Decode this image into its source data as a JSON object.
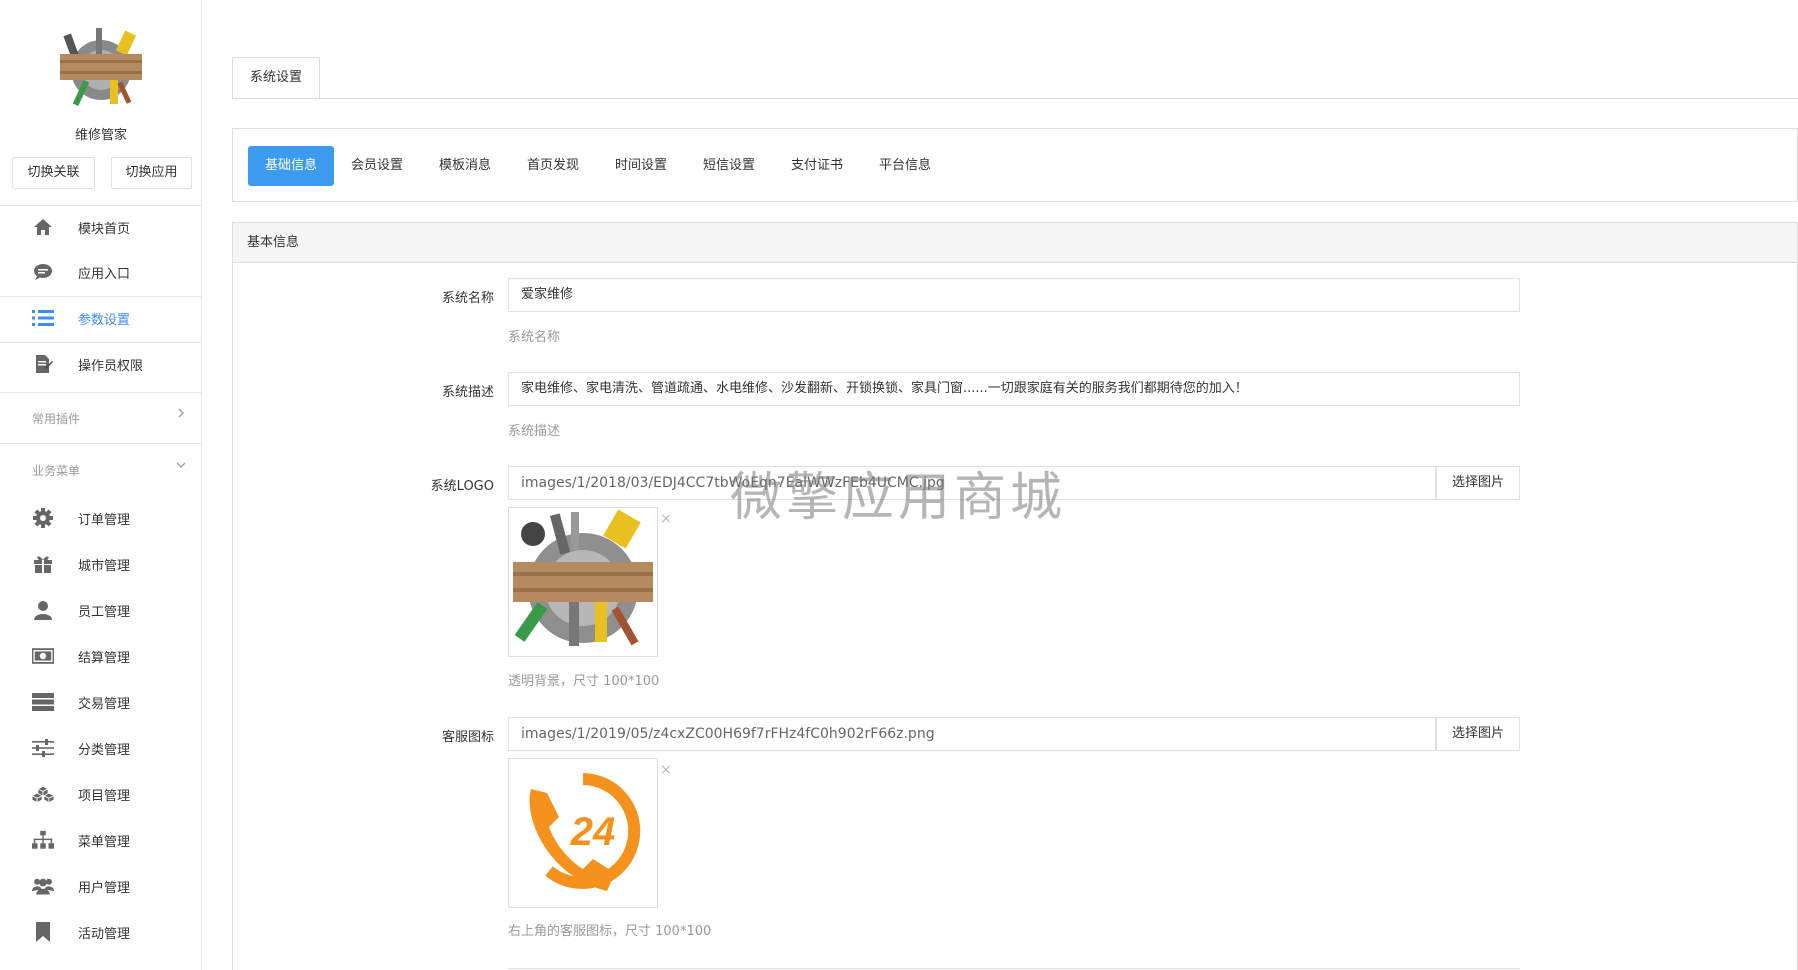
{
  "sidebar": {
    "app_name": "维修管家",
    "switch_link": "切换关联",
    "switch_app": "切换应用",
    "items": [
      {
        "label": "模块首页",
        "icon": "home-icon"
      },
      {
        "label": "应用入口",
        "icon": "chat-icon"
      },
      {
        "label": "参数设置",
        "icon": "list-icon"
      },
      {
        "label": "操作员权限",
        "icon": "edit-doc-icon"
      }
    ],
    "group_plugins": "常用插件",
    "group_business": "业务菜单",
    "business_items": [
      {
        "label": "订单管理",
        "icon": "gear-icon"
      },
      {
        "label": "城市管理",
        "icon": "gift-icon"
      },
      {
        "label": "员工管理",
        "icon": "user-icon"
      },
      {
        "label": "结算管理",
        "icon": "money-icon"
      },
      {
        "label": "交易管理",
        "icon": "server-icon"
      },
      {
        "label": "分类管理",
        "icon": "sliders-icon"
      },
      {
        "label": "项目管理",
        "icon": "cubes-icon"
      },
      {
        "label": "菜单管理",
        "icon": "sitemap-icon"
      },
      {
        "label": "用户管理",
        "icon": "users-icon"
      },
      {
        "label": "活动管理",
        "icon": "bookmark-icon"
      }
    ]
  },
  "main": {
    "top_tab": "系统设置",
    "subtabs": [
      "基础信息",
      "会员设置",
      "模板消息",
      "首页发现",
      "时间设置",
      "短信设置",
      "支付证书",
      "平台信息"
    ],
    "panel_title": "基本信息",
    "fields": {
      "name": {
        "label": "系统名称",
        "value": "爱家维修",
        "help": "系统名称"
      },
      "desc": {
        "label": "系统描述",
        "value": "家电维修、家电清洗、管道疏通、水电维修、沙发翻新、开锁换锁、家具门窗......一切跟家庭有关的服务我们都期待您的加入！",
        "help": "系统描述"
      },
      "logo": {
        "label": "系统LOGO",
        "value": "images/1/2018/03/EDJ4CC7tbWoEqn7EalWWzFEb4UCMC.jpg",
        "button": "选择图片",
        "help": "透明背景，尺寸 100*100"
      },
      "service": {
        "label": "客服图标",
        "value": "images/1/2019/05/z4cxZC00H69f7rFHz4fC0h902rF66z.png",
        "button": "选择图片",
        "help": "右上角的客服图标，尺寸 100*100"
      }
    },
    "close_glyph": "×",
    "service_badge": "24"
  },
  "watermark": "微擎应用商城",
  "colors": {
    "accent": "#3d9bef",
    "active_nav": "#3c8df5",
    "service_orange": "#f5921e"
  }
}
